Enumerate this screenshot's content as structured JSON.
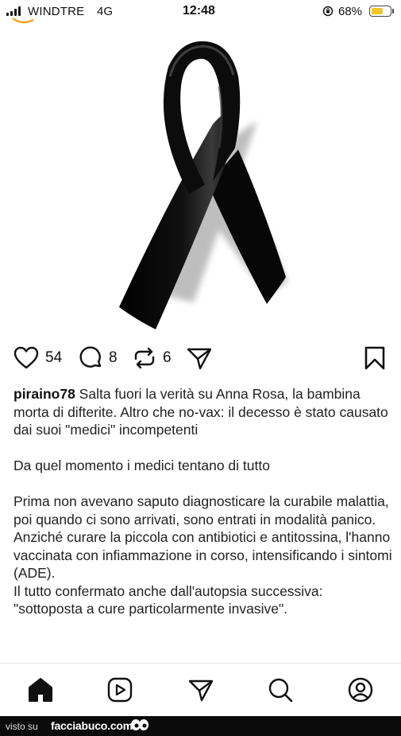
{
  "status_bar": {
    "carrier": "WINDTRE",
    "network": "4G",
    "time": "12:48",
    "battery_percent": "68%",
    "battery_level": 0.68,
    "battery_color": "#f3c623"
  },
  "post": {
    "image_icon": "black-mourning-ribbon",
    "likes": "54",
    "comments": "8",
    "reposts": "6",
    "caption": {
      "username": "piraino78",
      "text": " Salta fuori la verità su Anna Rosa, la bambina morta di difterite. Altro che no-vax: il decesso è stato causato dai suoi \"medici\" incompetenti",
      "paragraph2": "Da quel momento i medici tentano di tutto",
      "paragraph3": "Prima non avevano saputo diagnosticare la curabile malattia, poi quando ci sono arrivati, sono entrati in modalità panico.",
      "paragraph4": "Anziché curare la piccola con antibiotici e antitossina, l'hanno vaccinata con infiammazione in corso, intensificando i sintomi (ADE).",
      "paragraph5": "Il tutto confermato anche dall'autopsia successiva: \"sottoposta a cure particolarmente invasive\"."
    }
  },
  "icons": {
    "like": "heart-icon",
    "comment": "comment-icon",
    "repost": "repost-icon",
    "share": "share-icon",
    "save": "bookmark-icon"
  },
  "bottom_nav": {
    "items": [
      "home-icon",
      "reels-icon",
      "messages-icon",
      "search-icon",
      "profile-icon"
    ]
  },
  "footer": {
    "visto_su": "visto su",
    "site": "facciabuco.com"
  }
}
